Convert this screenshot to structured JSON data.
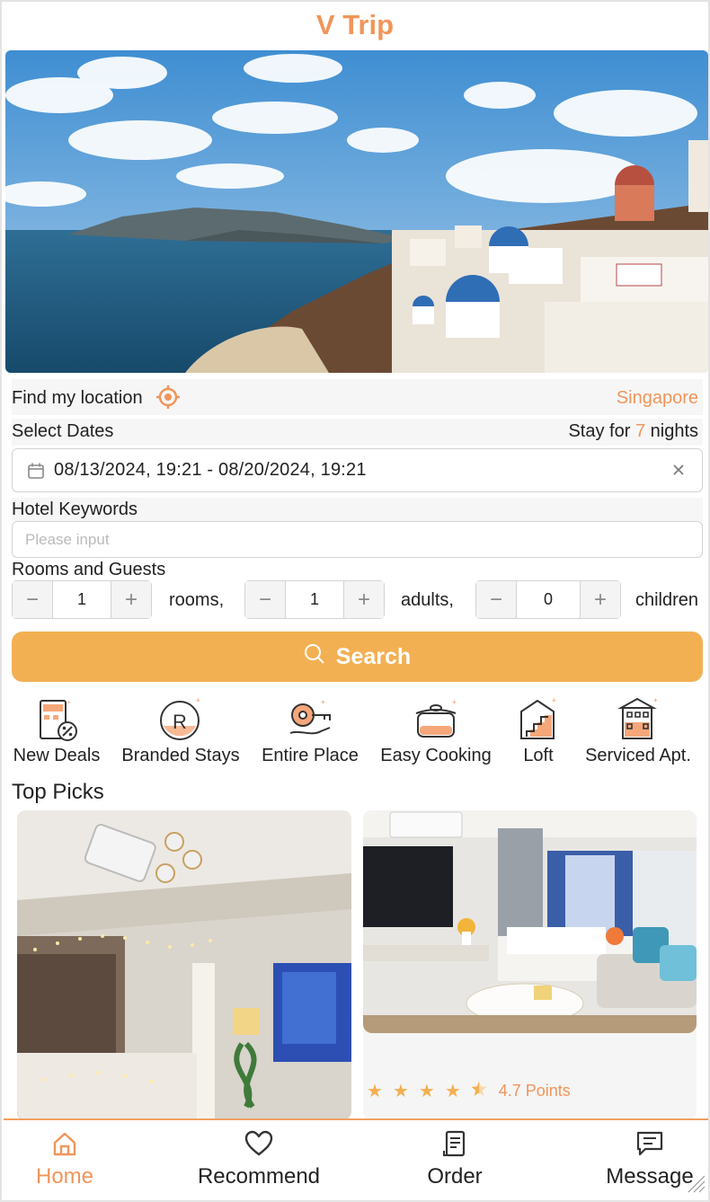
{
  "app": {
    "title": "V Trip"
  },
  "location": {
    "label": "Find my location",
    "city": "Singapore"
  },
  "dates": {
    "label": "Select Dates",
    "stay_prefix": "Stay for",
    "nights": "7",
    "stay_suffix": "nights",
    "range": "08/13/2024, 19:21 - 08/20/2024, 19:21"
  },
  "keywords": {
    "label": "Hotel Keywords",
    "placeholder": "Please input",
    "value": ""
  },
  "guests": {
    "label": "Rooms and Guests",
    "rooms": {
      "value": "1",
      "unit": "rooms,"
    },
    "adults": {
      "value": "1",
      "unit": "adults,"
    },
    "children": {
      "value": "0",
      "unit": "children"
    }
  },
  "search": {
    "label": "Search"
  },
  "categories": [
    {
      "label": "New Deals",
      "icon": "new-deals-icon"
    },
    {
      "label": "Branded Stays",
      "icon": "branded-stays-icon"
    },
    {
      "label": "Entire Place",
      "icon": "entire-place-icon"
    },
    {
      "label": "Easy Cooking",
      "icon": "cooking-pot-icon"
    },
    {
      "label": "Loft",
      "icon": "loft-icon"
    },
    {
      "label": "Serviced Apt.",
      "icon": "serviced-apartment-icon"
    }
  ],
  "top_picks": {
    "title": "Top Picks",
    "cards": [
      {
        "image": "projector-bedroom-photo"
      },
      {
        "image": "modern-hotel-room-photo",
        "rating_text": "4.7 Points",
        "stars": 4.5
      }
    ]
  },
  "tabs": [
    {
      "label": "Home",
      "icon": "home-icon",
      "active": true
    },
    {
      "label": "Recommend",
      "icon": "heart-icon",
      "active": false
    },
    {
      "label": "Order",
      "icon": "order-icon",
      "active": false
    },
    {
      "label": "Message",
      "icon": "message-icon",
      "active": false
    }
  ],
  "colors": {
    "accent": "#f0955a",
    "button": "#f3b052"
  }
}
